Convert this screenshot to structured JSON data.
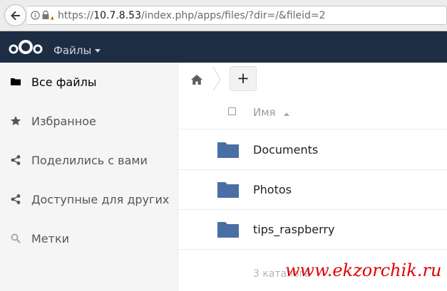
{
  "browser": {
    "url_prefix": "https://",
    "url_host": "10.7.8.53",
    "url_path": "/index.php/apps/files/?dir=/&fileid=2"
  },
  "app": {
    "title": "Файлы",
    "header_color": "#1d2d44",
    "logo_icon": "cloud-logo-icon"
  },
  "sidebar": {
    "items": [
      {
        "label": "Все файлы",
        "icon": "folder-icon",
        "active": true
      },
      {
        "label": "Избранное",
        "icon": "star-icon",
        "active": false
      },
      {
        "label": "Поделились с вами",
        "icon": "share-icon",
        "active": false
      },
      {
        "label": "Доступные для других",
        "icon": "share-icon",
        "active": false
      },
      {
        "label": "Метки",
        "icon": "search-icon",
        "active": false
      }
    ]
  },
  "toolbar": {
    "home_icon": "home-icon",
    "new_label": "+"
  },
  "file_list": {
    "column_name": "Имя",
    "folder_color": "#4a6fa5",
    "files": [
      {
        "name": "Documents",
        "type": "folder"
      },
      {
        "name": "Photos",
        "type": "folder"
      },
      {
        "name": "tips_raspberry",
        "type": "folder"
      }
    ],
    "summary": "3 каталога"
  },
  "watermark": {
    "text": "www.ekzorchik.ru",
    "color": "#e00000"
  }
}
